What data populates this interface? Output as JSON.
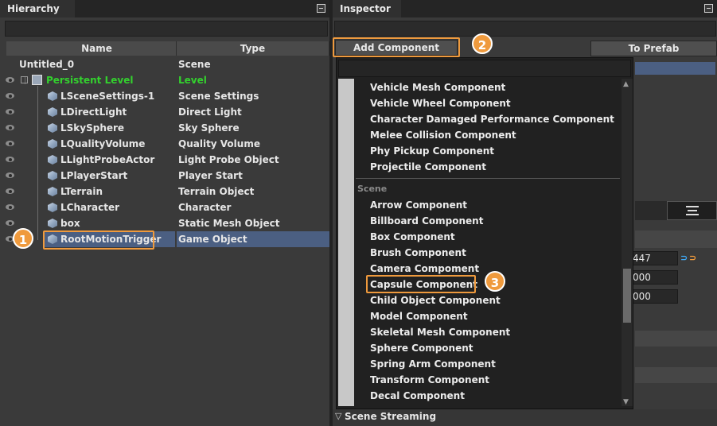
{
  "hierarchy": {
    "tab_label": "Hierarchy",
    "columns": {
      "name": "Name",
      "type": "Type"
    },
    "rows": [
      {
        "name": "Untitled_0",
        "type": "Scene"
      },
      {
        "name": "Persistent Level",
        "type": "Level"
      },
      {
        "name": "LSceneSettings-1",
        "type": "Scene Settings"
      },
      {
        "name": "LDirectLight",
        "type": "Direct Light"
      },
      {
        "name": "LSkySphere",
        "type": "Sky Sphere"
      },
      {
        "name": "LQualityVolume",
        "type": "Quality Volume"
      },
      {
        "name": "LLightProbeActor",
        "type": "Light Probe Object"
      },
      {
        "name": "LPlayerStart",
        "type": "Player Start"
      },
      {
        "name": "LTerrain",
        "type": "Terrain Object"
      },
      {
        "name": "LCharacter",
        "type": "Character"
      },
      {
        "name": "box",
        "type": "Static Mesh Object"
      },
      {
        "name": "RootMotionTrigger",
        "type": "Game Object"
      }
    ]
  },
  "inspector": {
    "tab_label": "Inspector",
    "add_component_label": "Add Component",
    "to_prefab_label": "To Prefab",
    "field_values": [
      "447",
      "000",
      "000"
    ],
    "scene_streaming_label": "Scene Streaming"
  },
  "dropdown": {
    "items_top": [
      "Vehicle Mesh Component",
      "Vehicle Wheel Component",
      "Character Damaged Performance Component",
      "Melee Collision Component",
      "Phy Pickup Component",
      "Projectile Component"
    ],
    "category": "Scene",
    "items_scene": [
      "Arrow Component",
      "Billboard Component",
      "Box Component",
      "Brush Component",
      "Camera Compoment",
      "Capsule Component",
      "Child Object Component",
      "Model Component",
      "Skeletal Mesh Component",
      "Sphere Component",
      "Spring Arm Component",
      "Transform Component",
      "Decal Component"
    ]
  },
  "callouts": [
    "1",
    "2",
    "3"
  ],
  "colors": {
    "accent_orange": "#ef9a3d",
    "level_green": "#33d12e",
    "selection_blue": "#4b5f82"
  }
}
